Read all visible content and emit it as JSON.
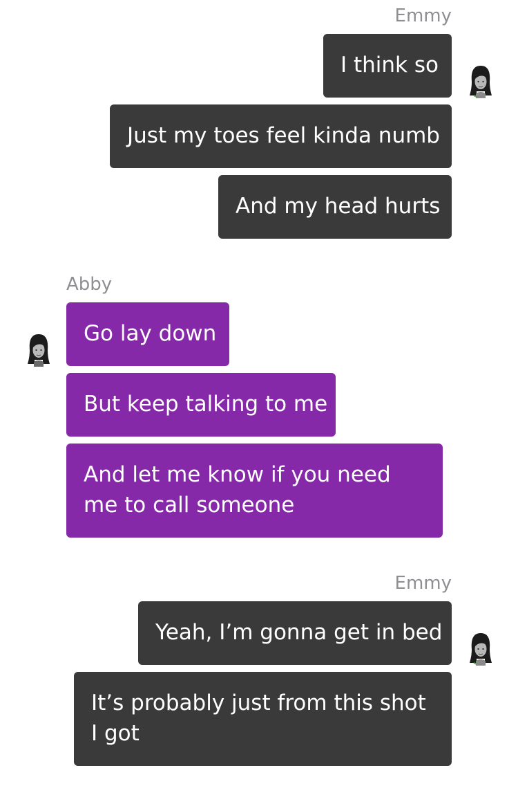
{
  "groups": [
    {
      "sender": "Emmy",
      "side": "out",
      "messages": [
        "I think so",
        "Just my toes feel kinda numb",
        "And my head hurts"
      ]
    },
    {
      "sender": "Abby",
      "side": "in",
      "messages": [
        "Go lay down",
        "But keep talking to me",
        "And let me know if you need me to call someone"
      ]
    },
    {
      "sender": "Emmy",
      "side": "out",
      "messages": [
        "Yeah, I’m gonna get in bed",
        "It’s probably just from this shot I got"
      ]
    }
  ],
  "colors": {
    "outgoing_bubble": "#3a3a3a",
    "incoming_bubble": "#8529a8",
    "sender_label": "#8e8e93"
  }
}
